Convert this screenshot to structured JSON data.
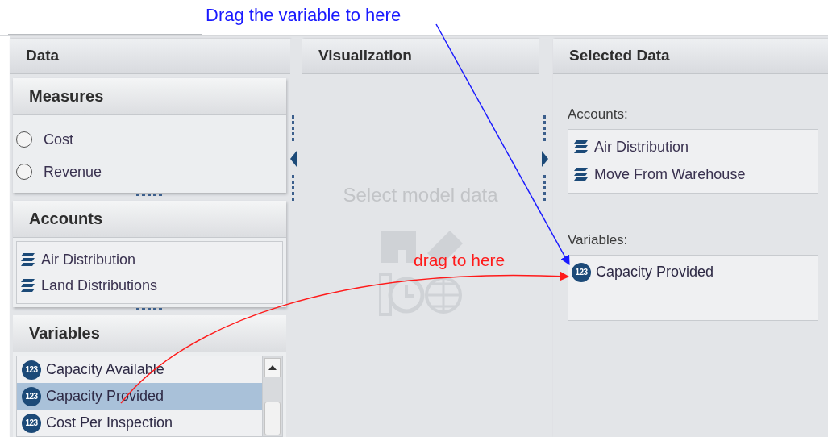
{
  "annotations": {
    "top_note": "Drag the variable to here",
    "arrow_note": "drag to here"
  },
  "data_panel": {
    "title": "Data",
    "measures": {
      "title": "Measures",
      "items": [
        {
          "label": "Cost",
          "selected": false
        },
        {
          "label": "Revenue",
          "selected": false
        }
      ]
    },
    "accounts": {
      "title": "Accounts",
      "items": [
        {
          "label": "Air Distribution"
        },
        {
          "label": "Land Distributions"
        }
      ]
    },
    "variables": {
      "title": "Variables",
      "items": [
        {
          "badge": "123",
          "label": "Capacity Available",
          "selected": false
        },
        {
          "badge": "123",
          "label": "Capacity Provided",
          "selected": true
        },
        {
          "badge": "123",
          "label": "Cost Per Inspection",
          "selected": false
        }
      ]
    }
  },
  "visualization": {
    "title": "Visualization",
    "empty_message": "Select model data"
  },
  "selected_data": {
    "title": "Selected Data",
    "accounts": {
      "label": "Accounts:",
      "items": [
        {
          "label": "Air Distribution"
        },
        {
          "label": "Move From Warehouse"
        }
      ]
    },
    "variables": {
      "label": "Variables:",
      "items": [
        {
          "badge": "123",
          "label": "Capacity Provided"
        }
      ]
    }
  }
}
